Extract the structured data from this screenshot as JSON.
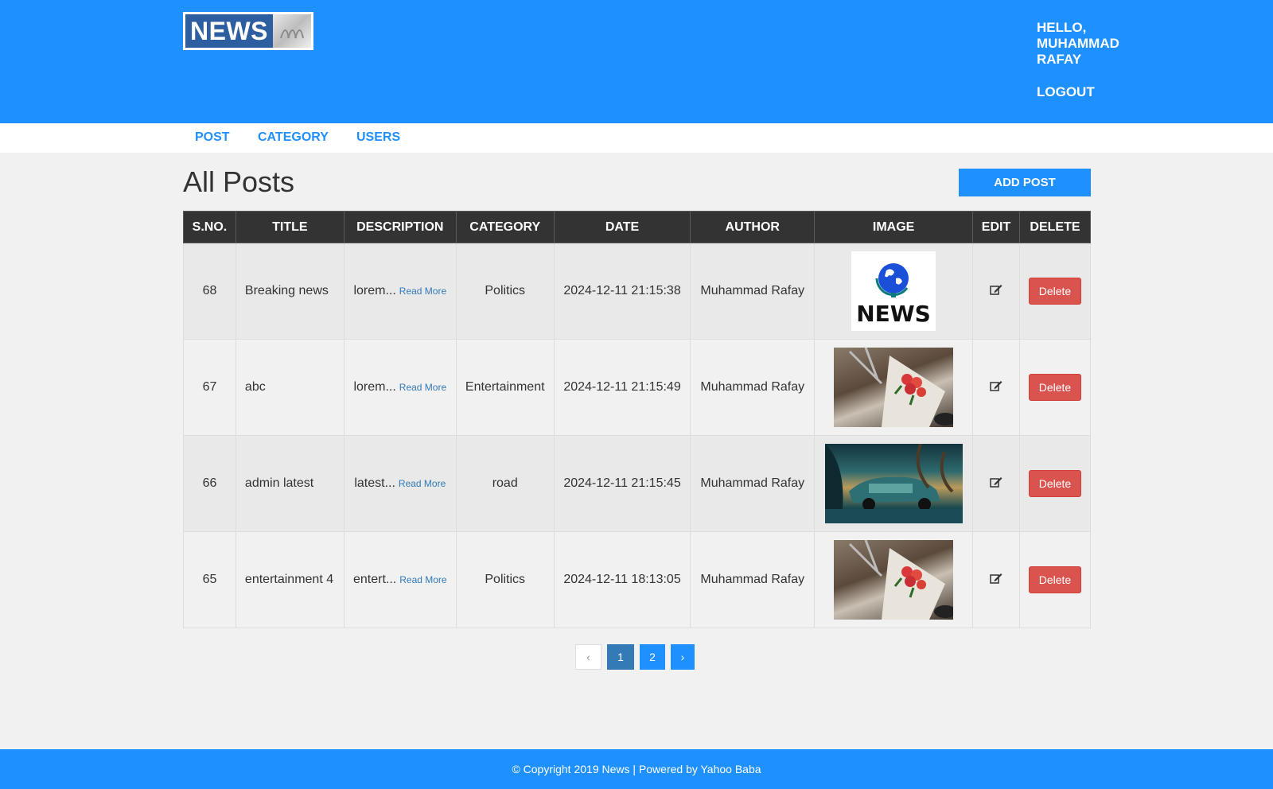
{
  "header": {
    "logo_text": "NEWS",
    "greeting": "HELLO, MUHAMMAD RAFAY",
    "logout_label": "LOGOUT"
  },
  "menu": {
    "items": [
      {
        "label": "POST"
      },
      {
        "label": "CATEGORY"
      },
      {
        "label": "USERS"
      }
    ]
  },
  "main": {
    "title": "All Posts",
    "add_post_label": "ADD POST",
    "table": {
      "headers": [
        "S.NO.",
        "TITLE",
        "DESCRIPTION",
        "CATEGORY",
        "DATE",
        "AUTHOR",
        "IMAGE",
        "EDIT",
        "DELETE"
      ],
      "rows": [
        {
          "sno": "68",
          "title": "Breaking news",
          "desc": "lorem...",
          "read_more": "Read More",
          "category": "Politics",
          "date": "2024-12-11 21:15:38",
          "author": "Muhammad Rafay",
          "image_text": "NEWS",
          "delete_label": "Delete"
        },
        {
          "sno": "67",
          "title": "abc",
          "desc": "lorem...",
          "read_more": "Read More",
          "category": "Entertainment",
          "date": "2024-12-11 21:15:49",
          "author": "Muhammad Rafay",
          "delete_label": "Delete"
        },
        {
          "sno": "66",
          "title": "admin latest",
          "desc": "latest...",
          "read_more": "Read More",
          "category": "road",
          "date": "2024-12-11 21:15:45",
          "author": "Muhammad Rafay",
          "delete_label": "Delete"
        },
        {
          "sno": "65",
          "title": "entertainment 4",
          "desc": "entert...",
          "read_more": "Read More",
          "category": "Politics",
          "date": "2024-12-11 18:13:05",
          "author": "Muhammad Rafay",
          "delete_label": "Delete"
        }
      ]
    },
    "pagination": {
      "prev": "‹",
      "pages": [
        "1",
        "2"
      ],
      "next": "›"
    }
  },
  "footer": {
    "text": "© Copyright 2019 News | Powered by Yahoo Baba"
  },
  "colors": {
    "primary": "#1e90ff",
    "header_dark": "#333333",
    "danger": "#d9534f",
    "link": "#337ab7"
  },
  "icons": {
    "edit": "edit-icon"
  }
}
